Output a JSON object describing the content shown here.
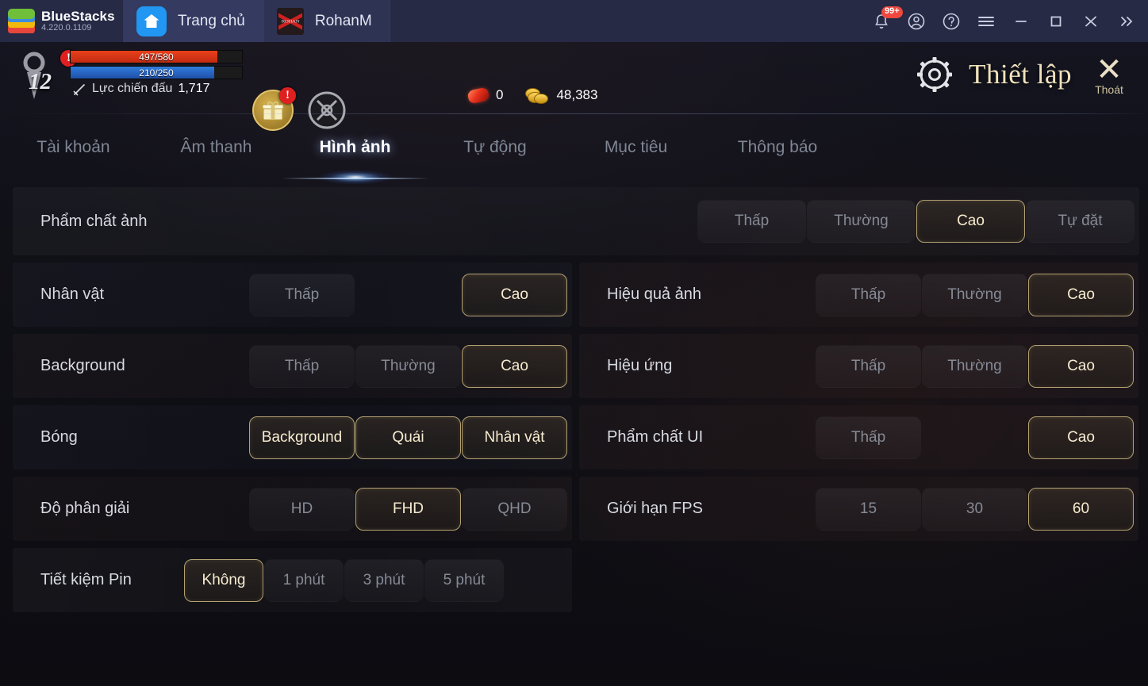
{
  "bluestacks": {
    "brand_name": "BlueStacks",
    "version": "4.220.0.1109",
    "tabs": [
      {
        "label": "Trang chủ",
        "icon": "home-icon",
        "active": true
      },
      {
        "label": "RohanM",
        "icon": "rohanm-game-icon",
        "active": false
      }
    ],
    "notification_badge": "99+",
    "actions": [
      {
        "name": "notifications-button",
        "glyph": "bell-icon"
      },
      {
        "name": "account-button",
        "glyph": "user-circle-icon"
      },
      {
        "name": "help-button",
        "glyph": "question-circle-icon"
      },
      {
        "name": "menu-button",
        "glyph": "hamburger-menu-icon"
      },
      {
        "name": "minimize-button",
        "glyph": "minimize-icon"
      },
      {
        "name": "maximize-button",
        "glyph": "maximize-icon"
      },
      {
        "name": "close-button",
        "glyph": "close-icon"
      },
      {
        "name": "expand-sidebar-button",
        "glyph": "chevron-double-right-icon"
      }
    ]
  },
  "hud": {
    "level": "12",
    "hp": {
      "value": "497/580",
      "current": 497,
      "max": 580
    },
    "mp": {
      "value": "210/250",
      "current": 210,
      "max": 250
    },
    "combat_power_label": "Lực chiến đấu",
    "combat_power_value": "1,717",
    "ruby_count": "0",
    "gold_count": "48,383",
    "alert_mark": "!"
  },
  "settings": {
    "title": "Thiết lập",
    "gear_icon": "gear-icon",
    "exit_label": "Thoát",
    "exit_icon": "close-icon",
    "tabs": [
      {
        "label": "Tài khoản",
        "active": false
      },
      {
        "label": "Âm thanh",
        "active": false
      },
      {
        "label": "Hình ảnh",
        "active": true
      },
      {
        "label": "Tự động",
        "active": false
      },
      {
        "label": "Mục tiêu",
        "active": false
      },
      {
        "label": "Thông báo",
        "active": false
      }
    ],
    "preset_row": {
      "label": "Phẩm chất ảnh",
      "options": [
        {
          "label": "Thấp",
          "selected": false
        },
        {
          "label": "Thường",
          "selected": false
        },
        {
          "label": "Cao",
          "selected": true
        },
        {
          "label": "Tự đặt",
          "selected": false
        }
      ]
    },
    "left_rows": [
      {
        "label": "Nhân vật",
        "options": [
          {
            "label": "Thấp",
            "selected": false
          },
          {
            "label": "",
            "selected": false,
            "empty": true
          },
          {
            "label": "Cao",
            "selected": true
          }
        ]
      },
      {
        "label": "Background",
        "options": [
          {
            "label": "Thấp",
            "selected": false
          },
          {
            "label": "Thường",
            "selected": false
          },
          {
            "label": "Cao",
            "selected": true
          }
        ]
      },
      {
        "label": "Bóng",
        "options": [
          {
            "label": "Background",
            "selected": true
          },
          {
            "label": "Quái",
            "selected": true
          },
          {
            "label": "Nhân vật",
            "selected": true
          }
        ]
      },
      {
        "label": "Độ phân giải",
        "options": [
          {
            "label": "HD",
            "selected": false
          },
          {
            "label": "FHD",
            "selected": true
          },
          {
            "label": "QHD",
            "selected": false
          }
        ]
      },
      {
        "label": "Tiết kiệm Pin",
        "options": [
          {
            "label": "Không",
            "selected": true
          },
          {
            "label": "1 phút",
            "selected": false
          },
          {
            "label": "3 phút",
            "selected": false
          },
          {
            "label": "5 phút",
            "selected": false
          }
        ]
      }
    ],
    "right_rows": [
      {
        "label": "Hiệu quả ảnh",
        "options": [
          {
            "label": "Thấp",
            "selected": false
          },
          {
            "label": "Thường",
            "selected": false
          },
          {
            "label": "Cao",
            "selected": true
          }
        ]
      },
      {
        "label": "Hiệu ứng",
        "options": [
          {
            "label": "Thấp",
            "selected": false
          },
          {
            "label": "Thường",
            "selected": false
          },
          {
            "label": "Cao",
            "selected": true
          }
        ]
      },
      {
        "label": "Phẩm chất UI",
        "options": [
          {
            "label": "Thấp",
            "selected": false
          },
          {
            "label": "",
            "selected": false,
            "empty": true
          },
          {
            "label": "Cao",
            "selected": true
          }
        ]
      },
      {
        "label": "Giới hạn FPS",
        "options": [
          {
            "label": "15",
            "selected": false
          },
          {
            "label": "30",
            "selected": false
          },
          {
            "label": "60",
            "selected": true
          }
        ]
      }
    ]
  },
  "colors": {
    "titlebar_bg": "#262a45",
    "tab_active_bg": "#343a60",
    "accent_gold": "#b3a172",
    "selected_text": "#f7ecd0",
    "unselected_text": "#868a95",
    "hp_red": "#e8401c",
    "mp_blue": "#2f7ddd",
    "badge_red": "#f0483e",
    "home_icon_blue": "#2196f3"
  }
}
